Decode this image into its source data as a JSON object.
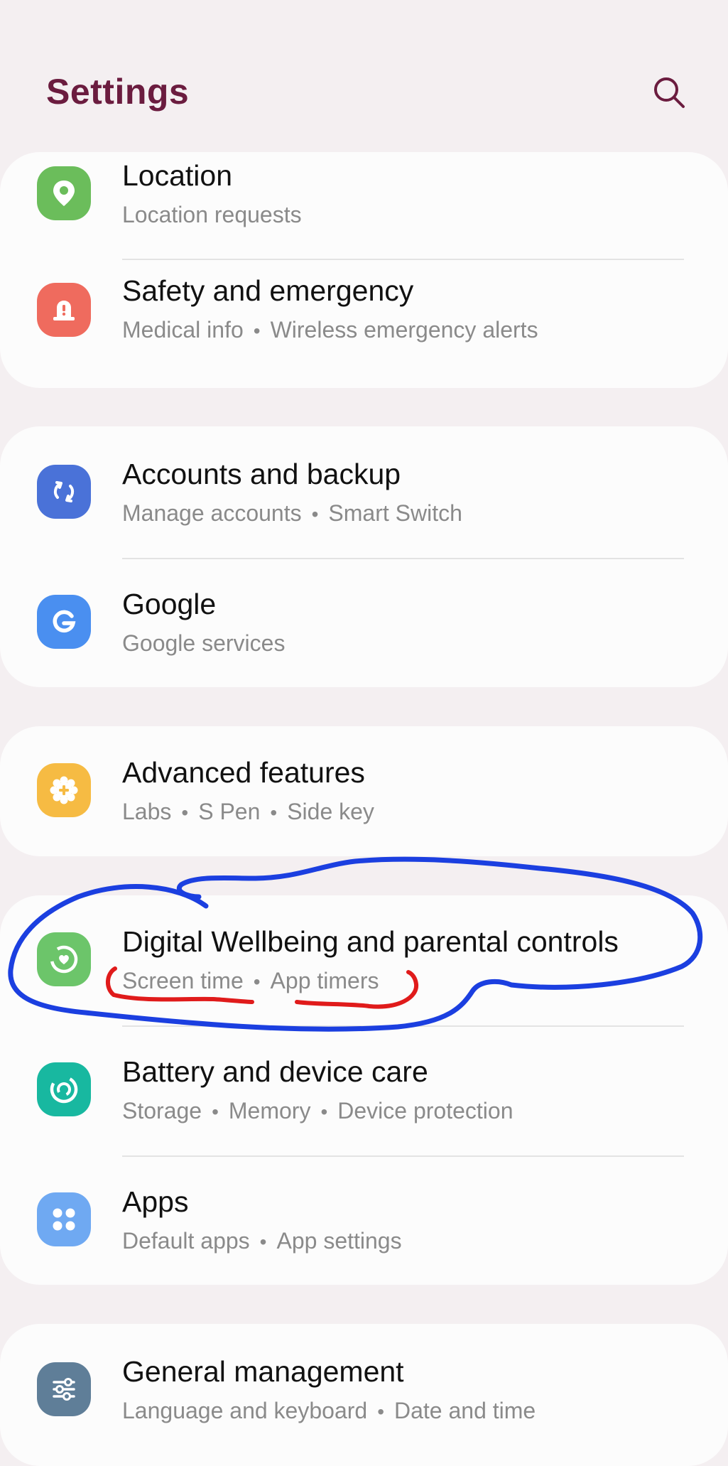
{
  "header": {
    "title": "Settings",
    "search_icon": "search-icon",
    "title_color": "#6b1c3f"
  },
  "groups": [
    {
      "items": [
        {
          "title": "Location",
          "subtitle": [
            "Location requests"
          ],
          "icon": "location-pin-icon",
          "icon_color": "#6bbd5b"
        },
        {
          "title": "Safety and emergency",
          "subtitle": [
            "Medical info",
            "Wireless emergency alerts"
          ],
          "icon": "emergency-beacon-icon",
          "icon_color": "#ef6b5e"
        }
      ]
    },
    {
      "items": [
        {
          "title": "Accounts and backup",
          "subtitle": [
            "Manage accounts",
            "Smart Switch"
          ],
          "icon": "sync-arrows-icon",
          "icon_color": "#4a72d8"
        },
        {
          "title": "Google",
          "subtitle": [
            "Google services"
          ],
          "icon": "google-g-icon",
          "icon_color": "#4a8ff0"
        }
      ]
    },
    {
      "items": [
        {
          "title": "Advanced features",
          "subtitle": [
            "Labs",
            "S Pen",
            "Side key"
          ],
          "icon": "gear-plus-icon",
          "icon_color": "#f6bb43"
        }
      ]
    },
    {
      "items": [
        {
          "title": "Digital Wellbeing and parental controls",
          "subtitle": [
            "Screen time",
            "App timers"
          ],
          "icon": "wellbeing-heart-icon",
          "icon_color": "#6cc56a"
        },
        {
          "title": "Battery and device care",
          "subtitle": [
            "Storage",
            "Memory",
            "Device protection"
          ],
          "icon": "device-care-icon",
          "icon_color": "#18b8a0"
        },
        {
          "title": "Apps",
          "subtitle": [
            "Default apps",
            "App settings"
          ],
          "icon": "apps-grid-icon",
          "icon_color": "#6fa9f2"
        }
      ]
    },
    {
      "items": [
        {
          "title": "General management",
          "subtitle": [
            "Language and keyboard",
            "Date and time"
          ],
          "icon": "sliders-icon",
          "icon_color": "#5f7e98"
        }
      ]
    }
  ],
  "annotations": {
    "circle_color": "#1b3fe0",
    "underline_color": "#e01b1b"
  }
}
